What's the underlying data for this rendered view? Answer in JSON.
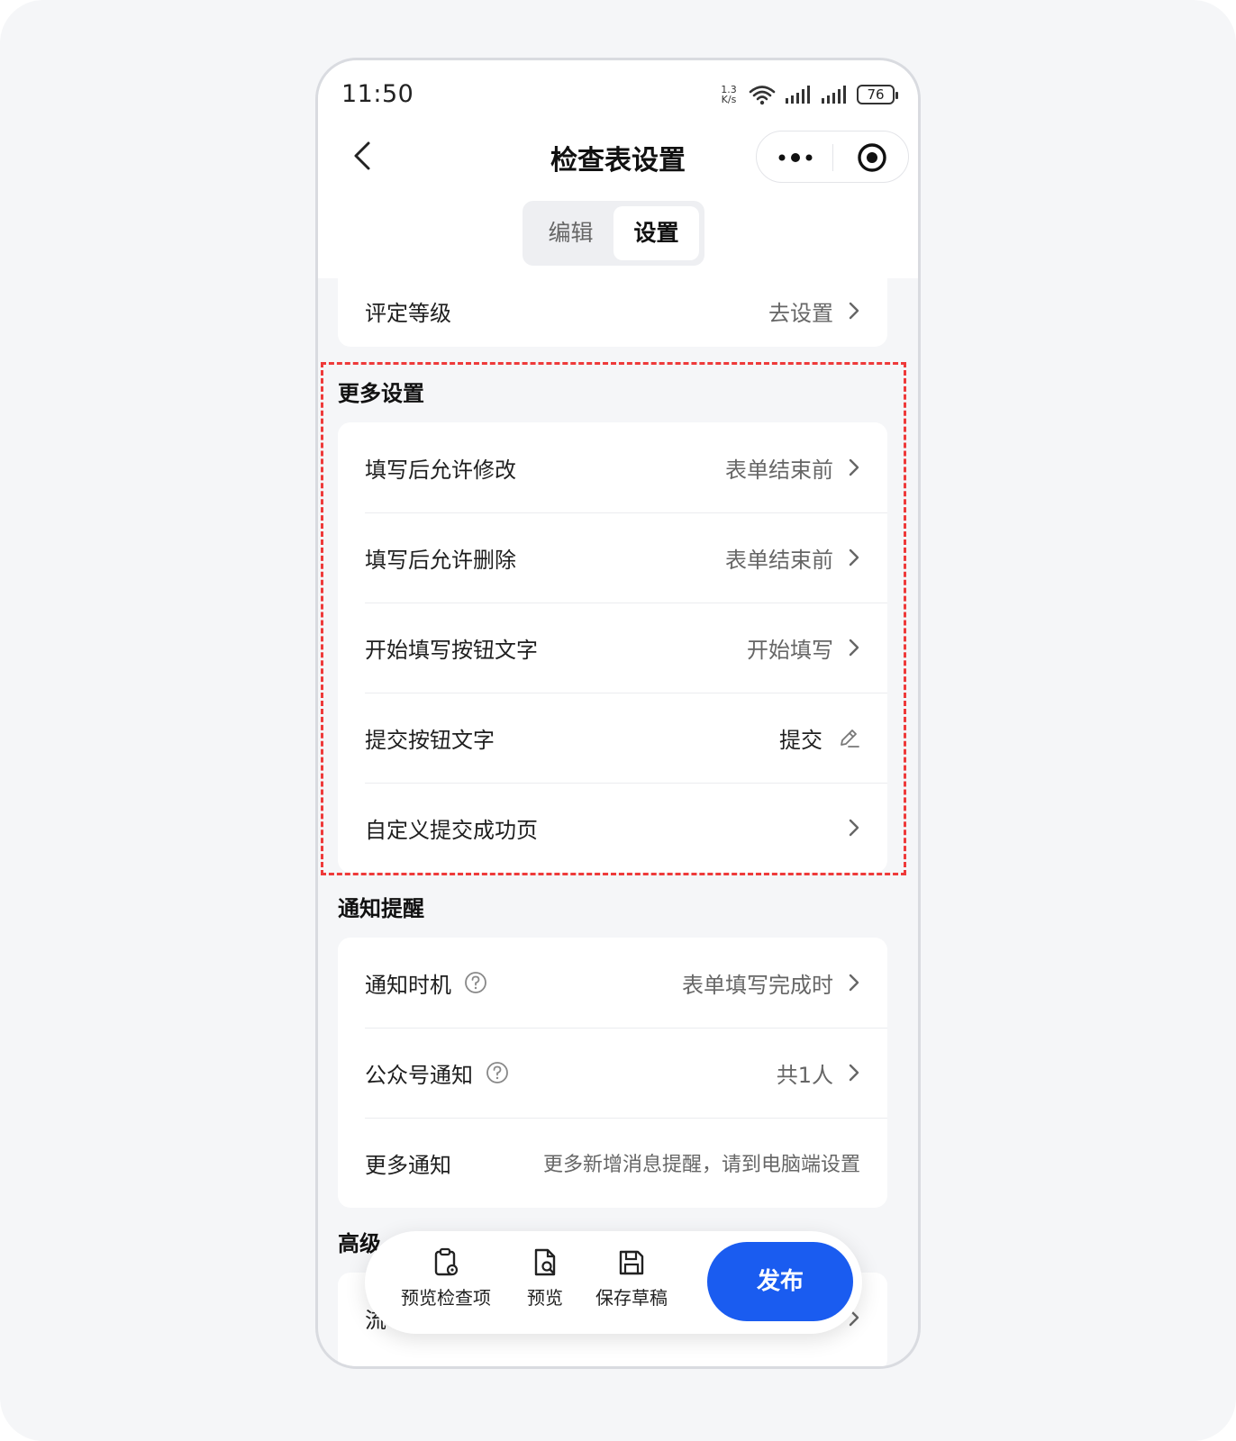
{
  "status_bar": {
    "time": "11:50",
    "net_speed_value": "1.3",
    "net_speed_unit": "K/s",
    "battery": "76"
  },
  "nav": {
    "title": "检查表设置",
    "tabs": [
      {
        "label": "编辑",
        "active": false
      },
      {
        "label": "设置",
        "active": true
      }
    ]
  },
  "rating": {
    "label": "评定等级",
    "value": "去设置"
  },
  "more_settings": {
    "title": "更多设置",
    "rows": [
      {
        "label": "填写后允许修改",
        "value": "表单结束前",
        "icon": "chevron-right-icon"
      },
      {
        "label": "填写后允许删除",
        "value": "表单结束前",
        "icon": "chevron-right-icon"
      },
      {
        "label": "开始填写按钮文字",
        "value": "开始填写",
        "icon": "chevron-right-icon"
      },
      {
        "label": "提交按钮文字",
        "value": "提交",
        "icon": "edit-pencil-icon"
      },
      {
        "label": "自定义提交成功页",
        "value": "",
        "icon": "chevron-right-icon"
      }
    ]
  },
  "notifications": {
    "title": "通知提醒",
    "rows": [
      {
        "label": "通知时机",
        "value": "表单填写完成时"
      },
      {
        "label": "公众号通知",
        "value": "共1人"
      },
      {
        "label": "更多通知",
        "value": "更多新增消息提醒，请到电脑端设置"
      }
    ]
  },
  "advanced": {
    "title": "高级",
    "first_row_label": "流"
  },
  "bottom_bar": {
    "preview_items": "预览检查项",
    "preview": "预览",
    "save_draft": "保存草稿",
    "publish": "发布"
  },
  "colors": {
    "accent": "#1a5cf0",
    "highlight_dash": "#ee3a3a",
    "background": "#f5f6f8"
  }
}
